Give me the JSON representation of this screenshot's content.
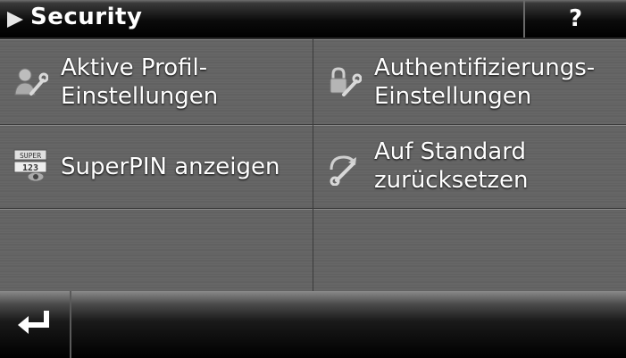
{
  "header": {
    "title": "Security",
    "help_label": "?"
  },
  "menu": {
    "items": [
      {
        "label": "Aktive Profil-\nEinstellungen",
        "icon": "profile-wrench-icon"
      },
      {
        "label": "Authentifizierungs-\nEinstellungen",
        "icon": "lock-wrench-icon"
      },
      {
        "label": "SuperPIN anzeigen",
        "icon": "superpin-icon",
        "icon_text": "SUPER 123"
      },
      {
        "label": "Auf Standard\nzurücksetzen",
        "icon": "reset-wrench-icon"
      }
    ]
  },
  "footer": {
    "back_icon": "return-arrow-icon"
  }
}
